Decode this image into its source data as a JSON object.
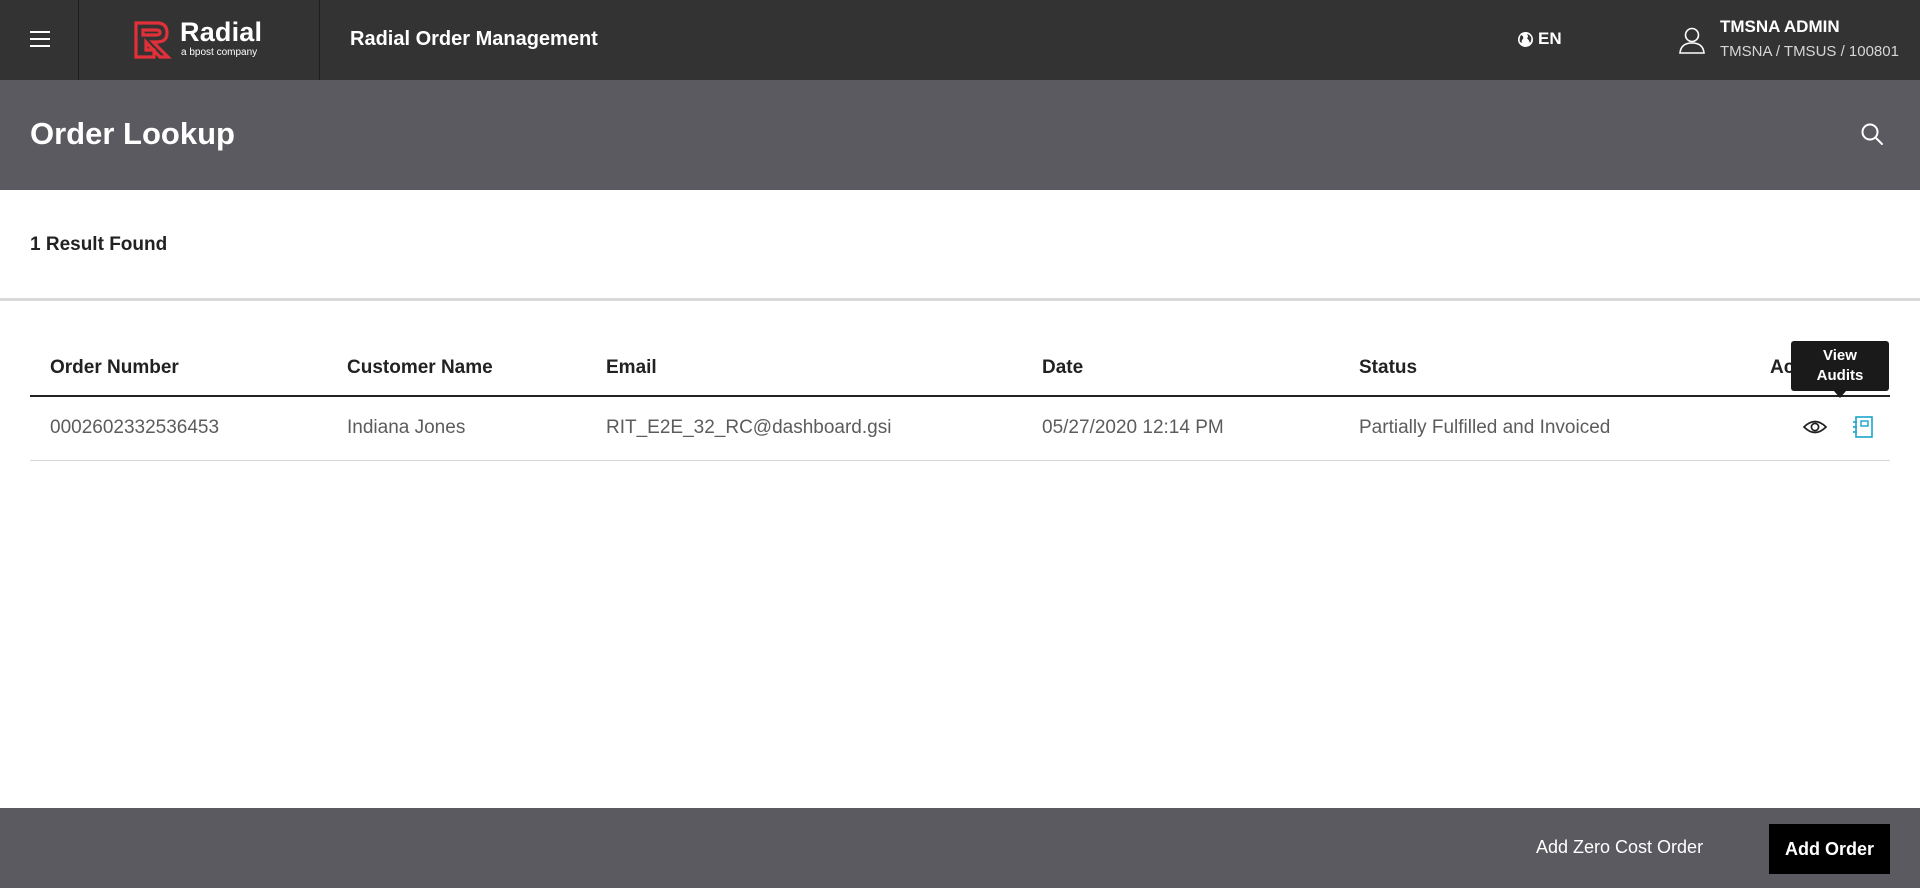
{
  "header": {
    "brand_name": "Radial",
    "brand_tagline": "a bpost company",
    "app_title": "Radial Order Management",
    "language": "EN",
    "user_name": "TMSNA ADMIN",
    "user_org": "TMSNA / TMSUS / 100801"
  },
  "page": {
    "title": "Order Lookup",
    "results_count": "1 Result Found"
  },
  "table": {
    "columns": [
      "Order Number",
      "Customer Name",
      "Email",
      "Date",
      "Status",
      "Actions"
    ],
    "rows": [
      {
        "order_number": "0002602332536453",
        "customer_name": "Indiana Jones",
        "email": "RIT_E2E_32_RC@dashboard.gsi",
        "date": "05/27/2020 12:14 PM",
        "status": "Partially Fulfilled and Invoiced"
      }
    ]
  },
  "tooltip": {
    "line1": "View",
    "line2": "Audits"
  },
  "footer": {
    "zero_cost_label": "Add Zero Cost Order",
    "add_order_label": "Add Order"
  },
  "colors": {
    "topbar": "#333333",
    "header_band": "#5a5a60",
    "brand_red": "#e0303a",
    "audit_icon": "#1aa5c8"
  },
  "icons": {
    "menu": "hamburger-icon",
    "globe": "globe-icon",
    "user": "user-icon",
    "search": "search-icon",
    "view": "eye-icon",
    "audits": "audit-document-icon"
  }
}
